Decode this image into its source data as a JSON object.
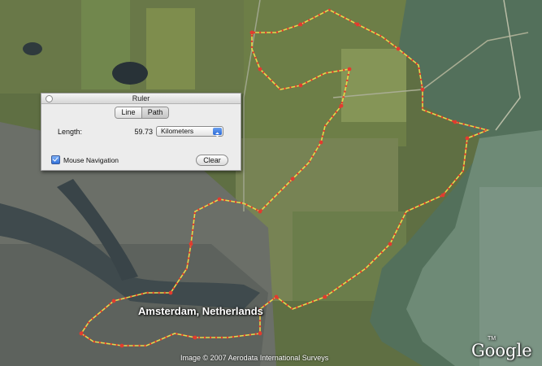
{
  "map": {
    "place_label": "Amsterdam, Netherlands",
    "copyright": "Image © 2007 Aerodata International Surveys",
    "logo": "Google",
    "logo_tm": "TM",
    "path_color": "#e23b2f",
    "path_secondary_color": "#e8d64a"
  },
  "ruler": {
    "title": "Ruler",
    "tabs": [
      {
        "label": "Line",
        "active": false
      },
      {
        "label": "Path",
        "active": true
      }
    ],
    "length_label": "Length:",
    "length_value": "59.73",
    "unit": "Kilometers",
    "mouse_navigation_label": "Mouse Navigation",
    "mouse_navigation_checked": true,
    "clear_label": "Clear"
  }
}
